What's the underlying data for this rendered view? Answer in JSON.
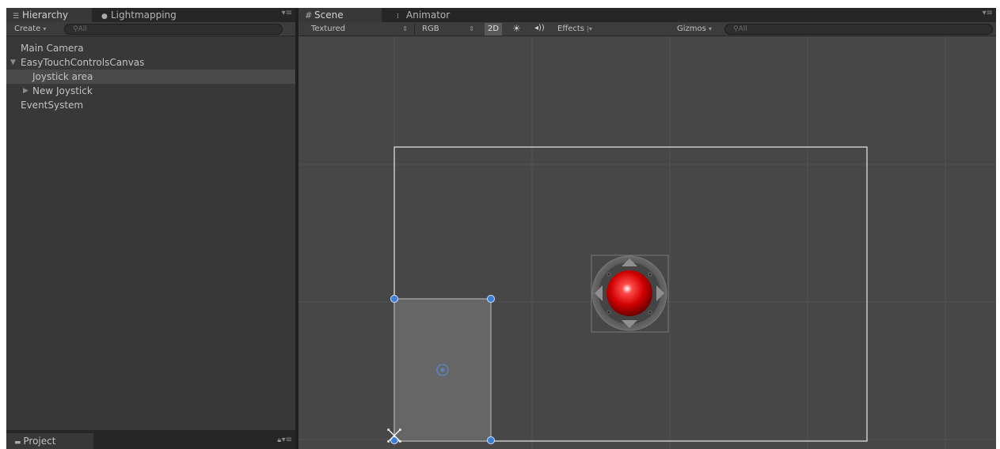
{
  "hierarchy_panel": {
    "tabs": [
      {
        "label": "Hierarchy",
        "icon": "list-icon"
      },
      {
        "label": "Lightmapping",
        "icon": "bulb-icon"
      }
    ],
    "create_label": "Create",
    "search_placeholder": "All",
    "tree": [
      {
        "label": "Main Camera",
        "depth": 0,
        "expanded": null,
        "selected": false
      },
      {
        "label": "EasyTouchControlsCanvas",
        "depth": 0,
        "expanded": true,
        "selected": false
      },
      {
        "label": "Joystick area",
        "depth": 1,
        "expanded": null,
        "selected": true
      },
      {
        "label": "New Joystick",
        "depth": 1,
        "expanded": false,
        "selected": false
      },
      {
        "label": "EventSystem",
        "depth": 0,
        "expanded": null,
        "selected": false
      }
    ]
  },
  "project_panel": {
    "tab_label": "Project"
  },
  "scene_panel": {
    "tabs": [
      {
        "label": "Scene",
        "icon": "grid-icon"
      },
      {
        "label": "Animator",
        "icon": "animator-icon"
      }
    ],
    "toolbar": {
      "shading_mode": "Textured",
      "render_mode": "RGB",
      "mode_2d_label": "2D",
      "effects_label": "Effects",
      "gizmos_label": "Gizmos",
      "search_placeholder": "All"
    }
  },
  "colors": {
    "selection_row": "#4a4a4a",
    "joystick_red": "#d10000",
    "handle_blue": "#3a7fd5",
    "canvas_outline": "#e8e8e8"
  }
}
